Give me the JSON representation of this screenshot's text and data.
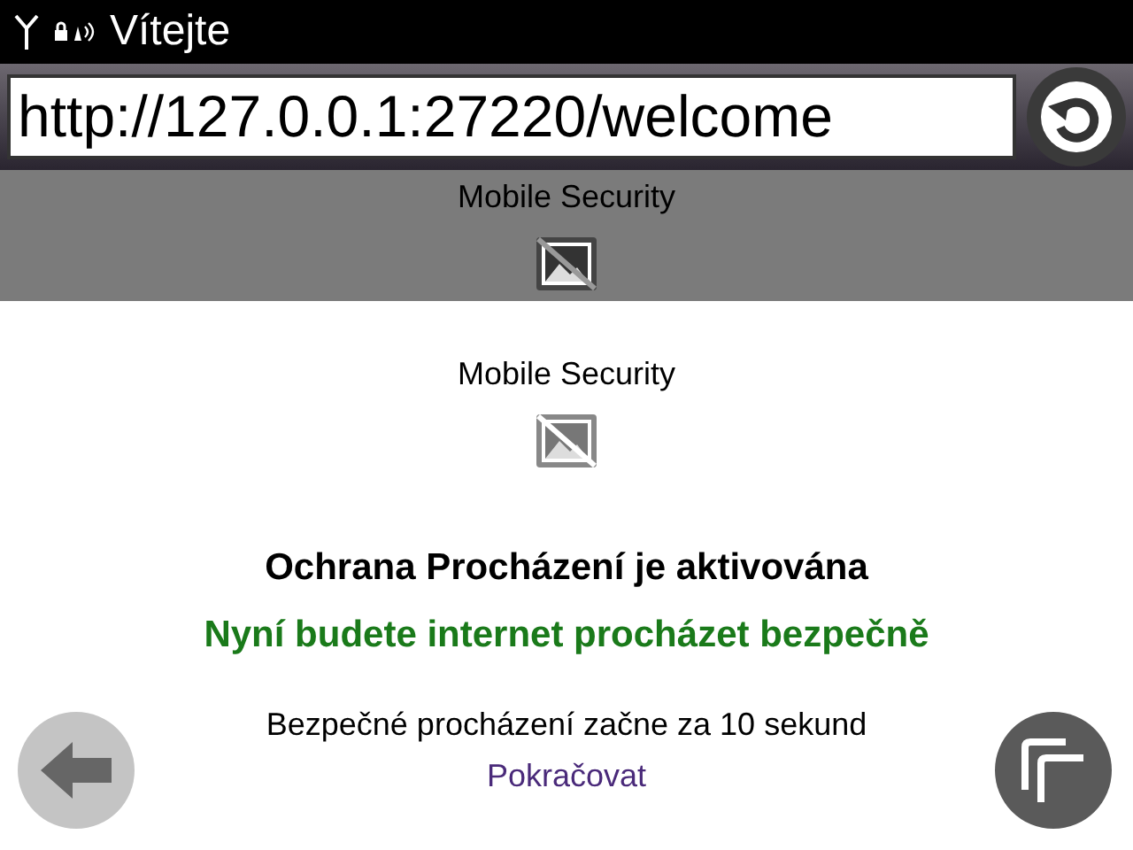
{
  "status_bar": {
    "title": "Vítejte"
  },
  "address_bar": {
    "value": "http://127.0.0.1:27220/welcome"
  },
  "page": {
    "banner": {
      "title": "Mobile Security"
    },
    "logo_title": "Mobile Security",
    "heading": "Ochrana Procházení je aktivována",
    "subheading": "Nyní budete internet procházet bezpečně",
    "countdown": "Bezpečné procházení začne za 10 sekund",
    "continue_link": "Pokračovat"
  },
  "back_button": {
    "disabled": true
  }
}
